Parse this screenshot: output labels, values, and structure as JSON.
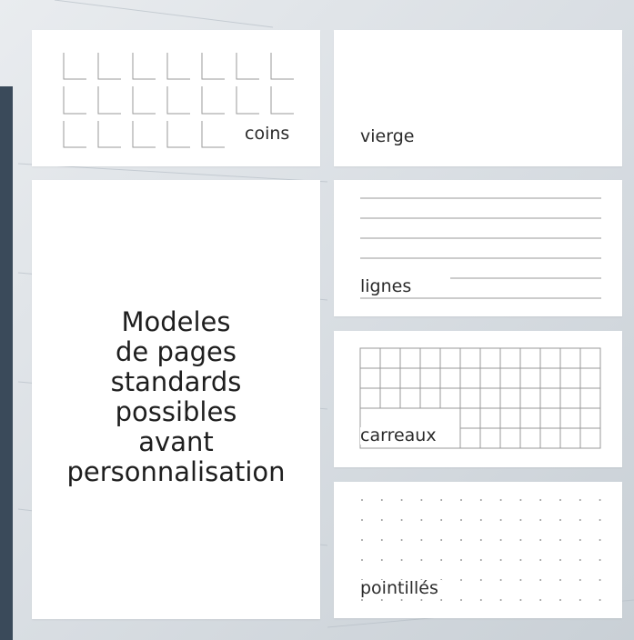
{
  "colors": {
    "background": "#dfe3e7",
    "card": "#ffffff",
    "rule": "#9a9a9a",
    "text": "#2b2b2b"
  },
  "templates": [
    {
      "id": "corners",
      "label": "coins"
    },
    {
      "id": "blank",
      "label": "vierge"
    },
    {
      "id": "lines",
      "label": "lignes"
    },
    {
      "id": "grid",
      "label": "carreaux"
    },
    {
      "id": "dots",
      "label": "pointillés"
    }
  ],
  "main_card": {
    "lines": [
      "Modeles",
      "de pages",
      "standards",
      "possibles",
      "avant",
      "personnalisation"
    ]
  }
}
